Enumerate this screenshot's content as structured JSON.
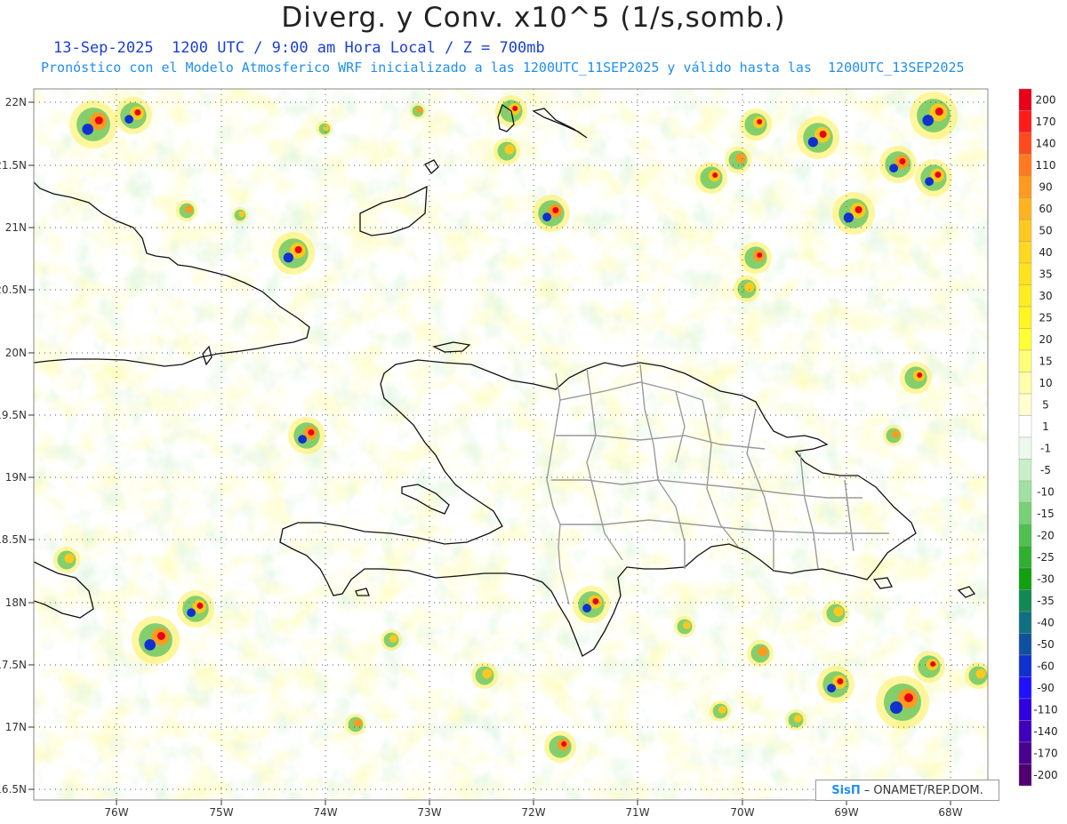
{
  "header": {
    "title": "Diverg. y Conv. x10^5 (1/s,somb.)",
    "subtitle_time": "13-Sep-2025  1200 UTC / 9:00 am Hora Local / Z = 700mb",
    "subtitle_model": "Pronóstico con el Modelo Atmosferico WRF inicializado a las 1200UTC_11SEP2025 y válido hasta las  1200UTC_13SEP2025"
  },
  "map": {
    "lat_labels": [
      "22N",
      "21.5N",
      "21N",
      "20.5N",
      "20N",
      "19.5N",
      "19N",
      "18.5N",
      "18N",
      "17.5N",
      "17N",
      "16.5N"
    ],
    "lon_labels": [
      "76W",
      "75W",
      "74W",
      "73W",
      "72W",
      "71W",
      "70W",
      "69W",
      "68W"
    ]
  },
  "colorbar": {
    "labels": [
      "200",
      "170",
      "140",
      "110",
      "90",
      "60",
      "50",
      "40",
      "35",
      "30",
      "25",
      "20",
      "15",
      "10",
      "5",
      "1",
      "-1",
      "-5",
      "-10",
      "-15",
      "-20",
      "-25",
      "-30",
      "-35",
      "-40",
      "-50",
      "-60",
      "-90",
      "-110",
      "-140",
      "-170",
      "-200"
    ],
    "colors": [
      "#e8001a",
      "#ff1a1a",
      "#ff4a1f",
      "#ff7a1f",
      "#ff9a1f",
      "#ffb41f",
      "#ffc81f",
      "#ffd81f",
      "#ffe31f",
      "#ffee1f",
      "#fff51f",
      "#ffff33",
      "#ffff7a",
      "#ffffaa",
      "#ffffd0",
      "#ffffff",
      "#eef9ee",
      "#c8f0c8",
      "#a0e0a0",
      "#78d078",
      "#50c050",
      "#30b030",
      "#10a010",
      "#108a50",
      "#107080",
      "#1050a0",
      "#1030d0",
      "#2010ff",
      "#3000e0",
      "#4000c0",
      "#4a0090",
      "#500070"
    ]
  },
  "credit": {
    "logo": "SisΠ",
    "text": "– ONAMET/REP.DOM."
  }
}
